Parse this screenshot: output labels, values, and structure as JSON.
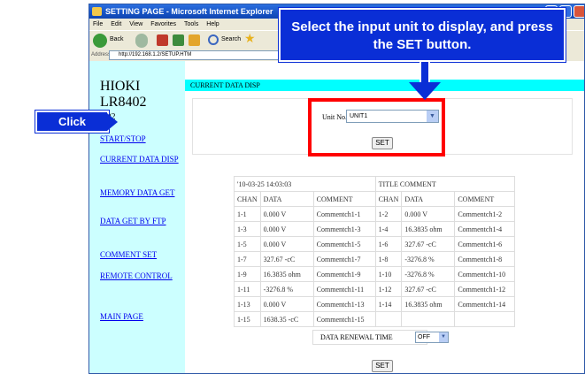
{
  "browser": {
    "title": "SETTING PAGE - Microsoft Internet Explorer",
    "menu": [
      "File",
      "Edit",
      "View",
      "Favorites",
      "Tools",
      "Help"
    ],
    "toolbar": {
      "back": "Back",
      "search": "Search"
    },
    "address_label": "Address",
    "address_url": "http://192.168.1.2/SETUP.HTM"
  },
  "sidebar": {
    "brand_line1": "HIOKI",
    "brand_line2": "LR8402",
    "version": "1.02",
    "links": [
      {
        "label": "START/STOP"
      },
      {
        "label": "CURRENT DATA DISP"
      },
      {
        "label": "MEMORY DATA GET"
      },
      {
        "label": "DATA GET BY FTP"
      },
      {
        "label": "COMMENT SET"
      },
      {
        "label": "REMOTE CONTROL"
      },
      {
        "label": "MAIN PAGE"
      }
    ]
  },
  "main": {
    "heading": "CURRENT DATA DISP",
    "unit_label": "Unit No.",
    "unit_value": "UNIT1",
    "set_label": "SET",
    "timestamp": "'10-03-25 14:03:03",
    "title_comment": "TITLE COMMENT",
    "columns": [
      "CHAN",
      "DATA",
      "COMMENT",
      "CHAN",
      "DATA",
      "COMMENT"
    ],
    "rows": [
      [
        "1-1",
        "0.000 V",
        "Commentch1-1",
        "1-2",
        "0.000 V",
        "Commentch1-2"
      ],
      [
        "1-3",
        "0.000 V",
        "Commentch1-3",
        "1-4",
        "16.3835 ohm",
        "Commentch1-4"
      ],
      [
        "1-5",
        "0.000 V",
        "Commentch1-5",
        "1-6",
        "327.67 -cC",
        "Commentch1-6"
      ],
      [
        "1-7",
        "327.67 -cC",
        "Commentch1-7",
        "1-8",
        "-3276.8 %",
        "Commentch1-8"
      ],
      [
        "1-9",
        "16.3835 ohm",
        "Commentch1-9",
        "1-10",
        "-3276.8 %",
        "Commentch1-10"
      ],
      [
        "1-11",
        "-3276.8 %",
        "Commentch1-11",
        "1-12",
        "327.67 -cC",
        "Commentch1-12"
      ],
      [
        "1-13",
        "0.000 V",
        "Commentch1-13",
        "1-14",
        "16.3835 ohm",
        "Commentch1-14"
      ],
      [
        "1-15",
        "1638.35 -cC",
        "Commentch1-15",
        "",
        "",
        ""
      ]
    ],
    "renewal_label": "DATA RENEWAL TIME",
    "renewal_value": "OFF",
    "set2_label": "SET"
  },
  "annotations": {
    "callout": "Select the input unit to display, and press the SET button.",
    "click": "Click"
  },
  "colors": {
    "callout_blue": "#0a2ed6",
    "highlight_red": "#ff0000",
    "sidebar_bg": "#ccffff",
    "heading_bg": "#00ffff"
  }
}
